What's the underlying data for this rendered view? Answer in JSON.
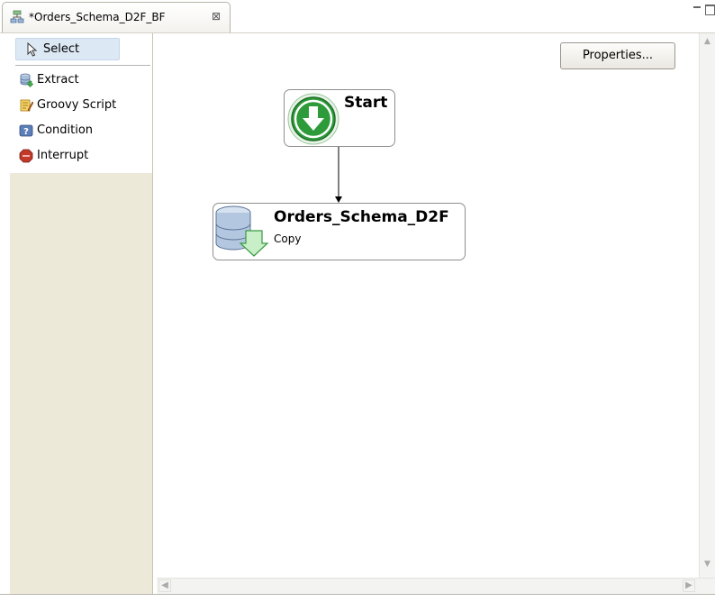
{
  "tab": {
    "title": "*Orders_Schema_D2F_BF",
    "close_glyph": "⊠",
    "icon": "business-flow-icon"
  },
  "palette": {
    "items": [
      {
        "label": "Select",
        "icon": "arrow-pointer-icon"
      },
      {
        "label": "Extract",
        "icon": "database-extract-icon"
      },
      {
        "label": "Groovy Script",
        "icon": "script-icon"
      },
      {
        "label": "Condition",
        "icon": "condition-icon"
      },
      {
        "label": "Interrupt",
        "icon": "stop-icon"
      }
    ]
  },
  "canvas": {
    "properties_button": "Properties...",
    "start_node": {
      "title": "Start",
      "icon": "start-arrow-icon"
    },
    "step_node": {
      "title": "Orders_Schema_D2F",
      "subtitle": "Copy",
      "icon": "database-copy-icon"
    }
  },
  "colors": {
    "palette_bg": "#ece9d8",
    "select_highlight": "#dde8f5",
    "start_green": "#2e9b3a",
    "interrupt_red": "#c0392b"
  }
}
